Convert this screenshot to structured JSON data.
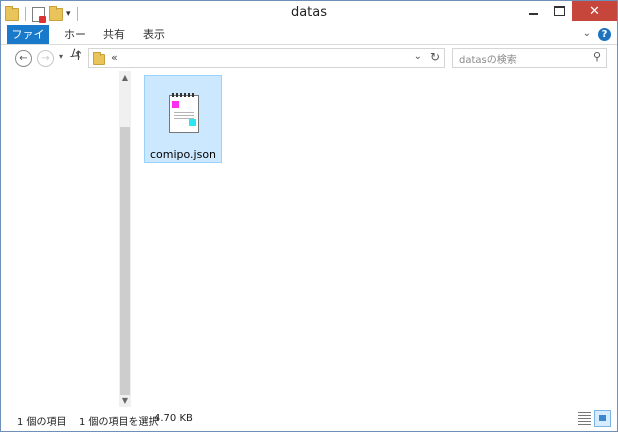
{
  "window": {
    "title": "datas"
  },
  "ribbon": {
    "tabs": [
      "ファイル",
      "ホーム",
      "共有",
      "表示"
    ],
    "help": "?"
  },
  "nav": {
    "back": "←",
    "forward": "→",
    "up": "↑",
    "address_text": "«",
    "refresh": "↻",
    "search_placeholder": "datasの検索",
    "search_glyph": "⚲"
  },
  "files": [
    {
      "name": "comipo.json",
      "icon": "notepad-icon",
      "selected": true
    }
  ],
  "status": {
    "item_count": "1 個の項目",
    "selected": "1 個の項目を選択",
    "size": "4.70 KB"
  },
  "colors": {
    "accent": "#1979ca",
    "selection": "#cce8ff",
    "close": "#c7463b"
  }
}
